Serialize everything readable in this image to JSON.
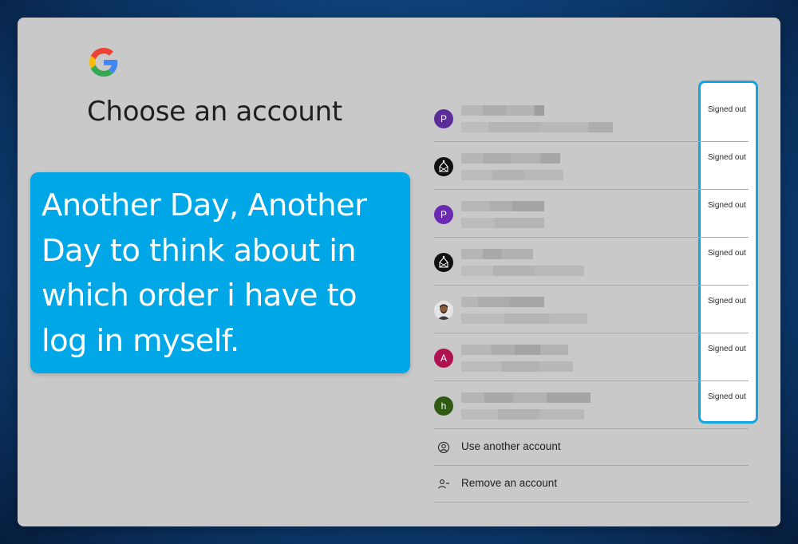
{
  "page": {
    "heading": "Choose an account",
    "callout": "Another Day, Another Day to think about in which order i have to log in myself."
  },
  "accounts": [
    {
      "initial": "P",
      "color": "#5b2d9a",
      "avatar_type": "letter",
      "status": "Signed out"
    },
    {
      "initial": "",
      "color": "#111111",
      "avatar_type": "logo",
      "status": "Signed out"
    },
    {
      "initial": "P",
      "color": "#6a2bb0",
      "avatar_type": "letter",
      "status": "Signed out"
    },
    {
      "initial": "",
      "color": "#111111",
      "avatar_type": "logo",
      "status": "Signed out"
    },
    {
      "initial": "",
      "color": "#dcdcdc",
      "avatar_type": "photo",
      "status": "Signed out"
    },
    {
      "initial": "A",
      "color": "#b0124f",
      "avatar_type": "letter",
      "status": "Signed out"
    },
    {
      "initial": "h",
      "color": "#2f5a12",
      "avatar_type": "letter",
      "status": "Signed out"
    }
  ],
  "actions": {
    "use_another": "Use another account",
    "remove": "Remove an account"
  },
  "colors": {
    "callout_bg": "#00a7e6",
    "highlight_border": "#13a5e0",
    "card_bg": "#c9c9c9"
  },
  "icons": {
    "logo": "google-logo-icon",
    "use_another": "account-circle-icon",
    "remove": "person-remove-icon"
  }
}
